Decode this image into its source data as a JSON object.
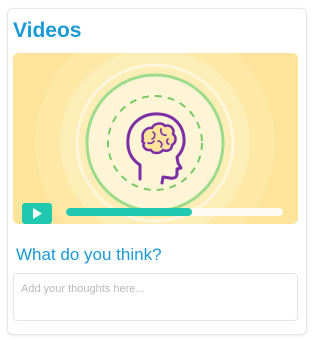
{
  "widget": {
    "title": "Videos"
  },
  "video": {
    "icon": "head-brain-icon",
    "progress": 0.58,
    "colors": {
      "background": "#fce49b",
      "accent": "#20c8b0",
      "head_outline": "#7b2fa6",
      "brain_outline": "#7bc86a"
    }
  },
  "feedback": {
    "question": "What do you think?",
    "placeholder": "Add your thoughts here..."
  }
}
